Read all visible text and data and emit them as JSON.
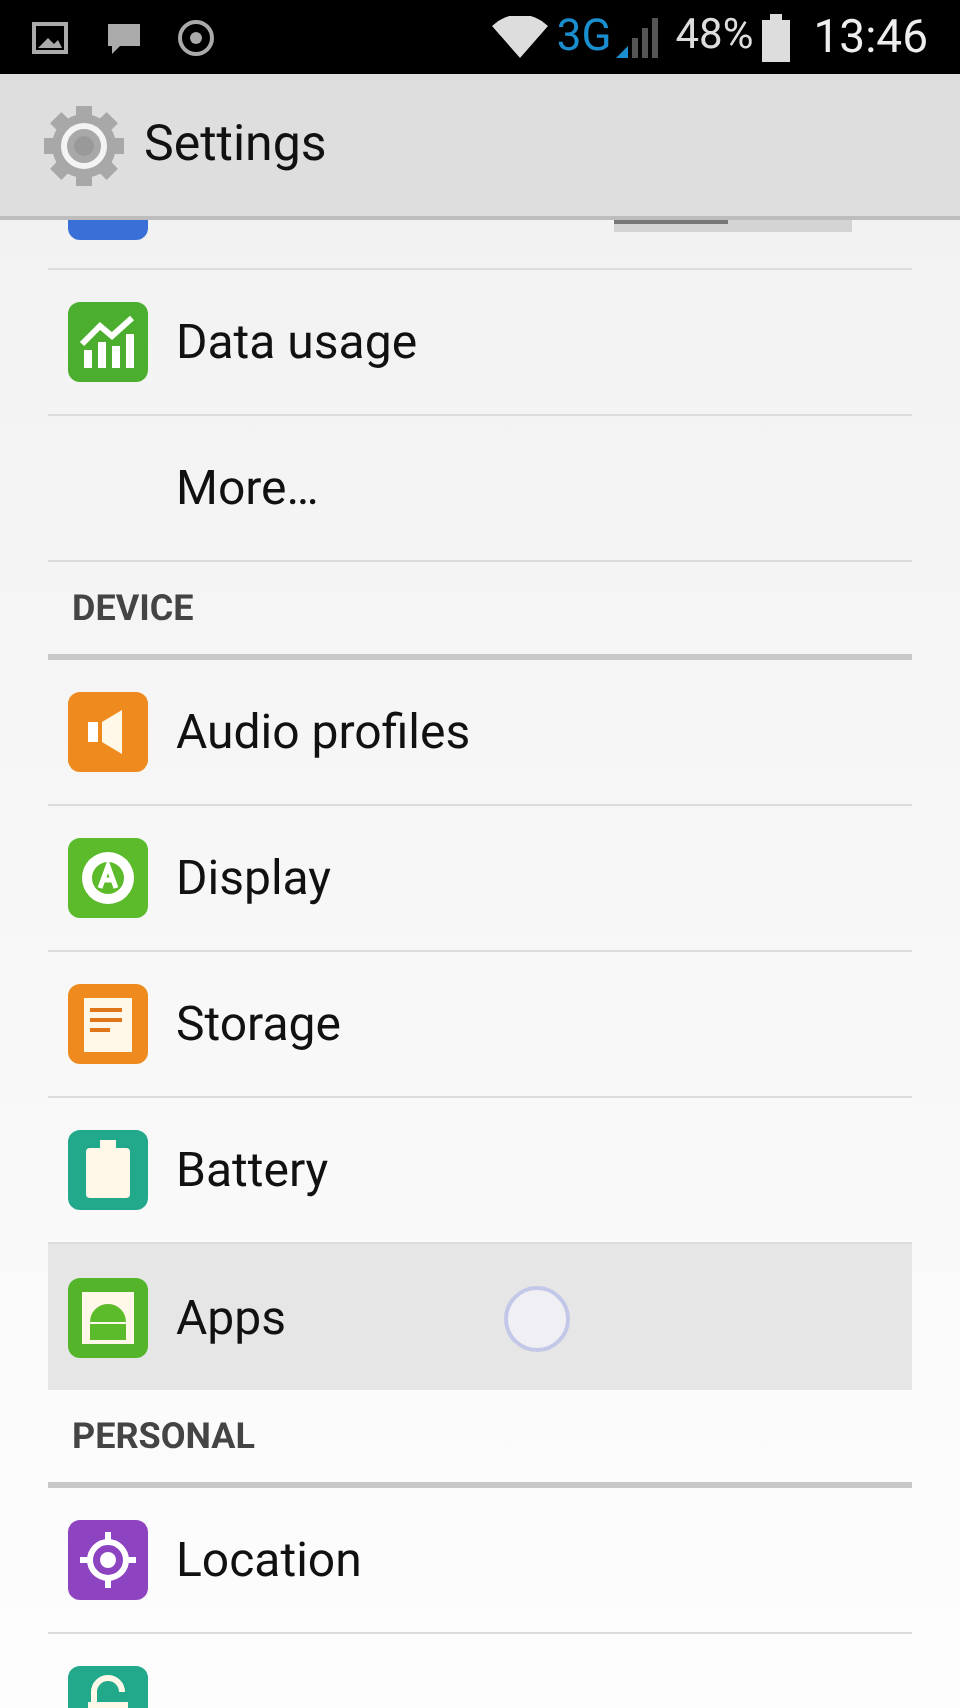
{
  "status_bar": {
    "network": "3G",
    "battery": "48%",
    "time": "13:46"
  },
  "action_bar": {
    "title": "Settings"
  },
  "partial_row": {
    "level": 0.48
  },
  "list": [
    {
      "kind": "item",
      "label": "Data usage",
      "selected": false
    },
    {
      "kind": "item",
      "label": "More…",
      "selected": false
    },
    {
      "kind": "section",
      "label": "DEVICE"
    },
    {
      "kind": "item",
      "label": "Audio profiles",
      "selected": false
    },
    {
      "kind": "item",
      "label": "Display",
      "selected": false
    },
    {
      "kind": "item",
      "label": "Storage",
      "selected": false
    },
    {
      "kind": "item",
      "label": "Battery",
      "selected": false
    },
    {
      "kind": "item",
      "label": "Apps",
      "selected": true
    },
    {
      "kind": "section",
      "label": "PERSONAL"
    },
    {
      "kind": "item",
      "label": "Location",
      "selected": false
    },
    {
      "kind": "item",
      "selected": false
    }
  ]
}
